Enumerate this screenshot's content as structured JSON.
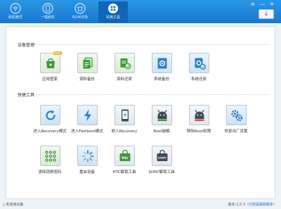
{
  "nav": {
    "items": [
      {
        "label": "刷机精灵",
        "icon": "wifi-icon"
      },
      {
        "label": "一键刷机",
        "icon": "phone-flash-icon"
      },
      {
        "label": "ROM市场",
        "icon": "rom-market-icon"
      },
      {
        "label": "实用工具",
        "icon": "tools-grid-icon",
        "active": true
      }
    ]
  },
  "window_controls": {
    "menu": "≡",
    "minimize": "—",
    "close": "✕"
  },
  "update_button": {
    "symbol": "↓"
  },
  "sections": {
    "device_management": {
      "title": "设备管理",
      "tools": [
        {
          "label": "应用管家",
          "icon": "app-manager-icon",
          "badge": "NEW"
        },
        {
          "label": "资料备份",
          "icon": "data-backup-icon"
        },
        {
          "label": "资料还原",
          "icon": "data-restore-icon"
        },
        {
          "label": "系统备份",
          "icon": "system-backup-icon"
        },
        {
          "label": "系统还原",
          "icon": "system-restore-icon"
        }
      ]
    },
    "quick_tools": {
      "title": "快捷工具",
      "tools": [
        {
          "label": "进入Recovery模式",
          "icon": "recovery-mode-icon"
        },
        {
          "label": "进入Fastboot模式",
          "icon": "fastboot-mode-icon"
        },
        {
          "label": "刷入Recovery",
          "icon": "flash-recovery-icon"
        },
        {
          "label": "Root破解",
          "icon": "root-icon"
        },
        {
          "label": "移除Root权限",
          "icon": "remove-root-icon"
        },
        {
          "label": "恢复出厂设置",
          "icon": "factory-reset-icon"
        },
        {
          "label": "清除锁屏密码",
          "icon": "clear-lock-pattern-icon"
        },
        {
          "label": "重启设备",
          "icon": "reboot-icon"
        },
        {
          "label": "HTC解锁工具",
          "icon": "htc-unlock-icon"
        },
        {
          "label": "SONY解锁工具",
          "icon": "sony-unlock-icon"
        }
      ]
    }
  },
  "status": {
    "device": "未连接设备",
    "version_text": "版本:1.0.3（",
    "version_link": "已经是最新版本",
    "version_close": "）"
  },
  "colors": {
    "titlebar": "#1a78cf",
    "accent": "#1a6ec5",
    "icon_blue": "#2f7fc8",
    "icon_green": "#3c9a3a"
  }
}
